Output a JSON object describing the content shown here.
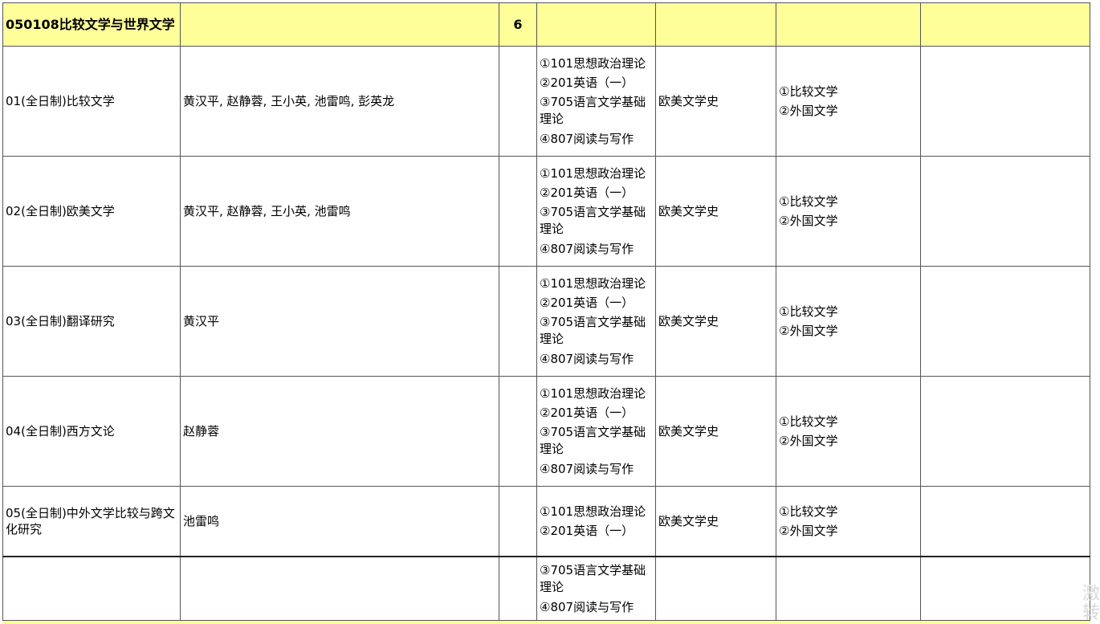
{
  "header": {
    "code": "050108比较文学与世界文学",
    "count": "6"
  },
  "rows": [
    {
      "direction": "01(全日制)比较文学",
      "advisors": "黄汉平, 赵静蓉, 王小英, 池雷鸣, 彭英龙",
      "subjects": [
        "①101思想政治理论",
        "②201英语（一）",
        "③705语言文学基础理论",
        "④807阅读与写作"
      ],
      "addon": "欧美文学史",
      "retest": [
        "①比较文学",
        "②外国文学"
      ]
    },
    {
      "direction": "02(全日制)欧美文学",
      "advisors": "黄汉平, 赵静蓉, 王小英, 池雷鸣",
      "subjects": [
        "①101思想政治理论",
        "②201英语（一）",
        "③705语言文学基础理论",
        "④807阅读与写作"
      ],
      "addon": "欧美文学史",
      "retest": [
        "①比较文学",
        "②外国文学"
      ]
    },
    {
      "direction": "03(全日制)翻译研究",
      "advisors": "黄汉平",
      "subjects": [
        "①101思想政治理论",
        "②201英语（一）",
        "③705语言文学基础理论",
        "④807阅读与写作"
      ],
      "addon": "欧美文学史",
      "retest": [
        "①比较文学",
        "②外国文学"
      ]
    },
    {
      "direction": "04(全日制)西方文论",
      "advisors": "赵静蓉",
      "subjects": [
        "①101思想政治理论",
        "②201英语（一）",
        "③705语言文学基础理论",
        "④807阅读与写作"
      ],
      "addon": "欧美文学史",
      "retest": [
        "①比较文学",
        "②外国文学"
      ]
    },
    {
      "direction": "05(全日制)中外文学比较与跨文化研究",
      "advisors": "池雷鸣",
      "subjects": [
        "①101思想政治理论",
        "②201英语（一）"
      ],
      "addon": "欧美文学史",
      "retest": [
        "①比较文学",
        "②外国文学"
      ]
    }
  ],
  "continuation": {
    "subjects": [
      "③705语言文学基础理论",
      "④807阅读与写作"
    ]
  },
  "watermark": {
    "line1": "激",
    "line2": "转"
  },
  "colors": {
    "header_bg": "#ffff99",
    "border": "#555555"
  }
}
